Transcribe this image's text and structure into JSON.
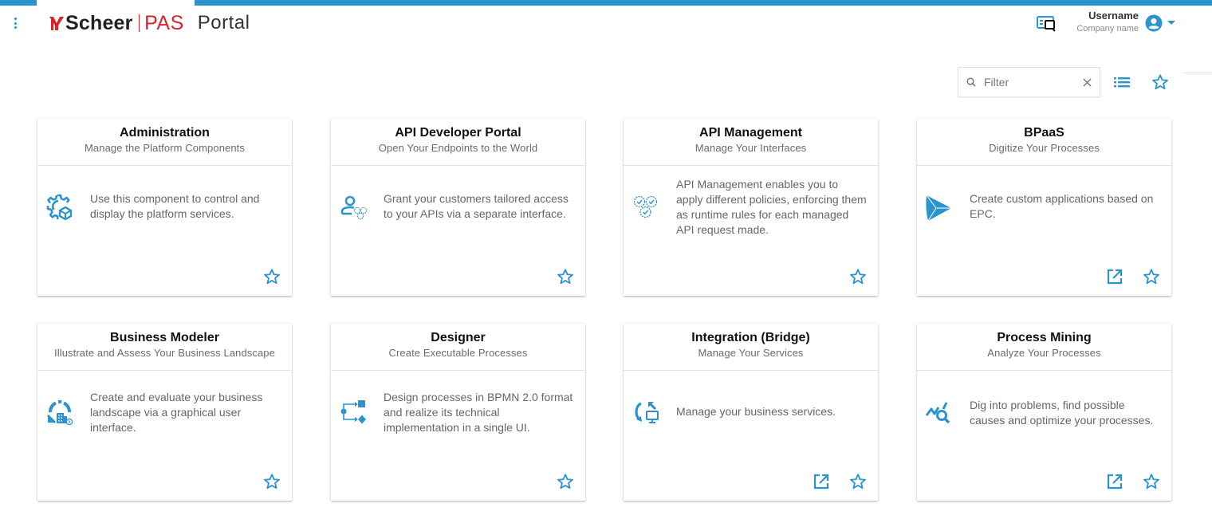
{
  "header": {
    "brand_name": "Scheer",
    "brand_product": "PAS",
    "app_title": "Portal",
    "user": {
      "name": "Username",
      "company": "Company name"
    },
    "icons": {
      "menu": "kebab-menu-icon",
      "inbox": "inbox-icon",
      "avatar": "account-circle-icon",
      "avatar_menu": "caret-down-icon"
    }
  },
  "toolbar": {
    "filter": {
      "placeholder": "Filter",
      "value": ""
    },
    "icons": {
      "search": "search-icon",
      "clear": "close-icon",
      "list_view": "list-view-icon",
      "favorites": "star-outline-icon"
    }
  },
  "colors": {
    "accent": "#2b93cd",
    "brand_red": "#d8232a"
  },
  "cards": [
    {
      "title": "Administration",
      "subtitle": "Manage the Platform Components",
      "description": "Use this component to control and display the platform services.",
      "icon": "gear-cube-icon",
      "has_open_link": false,
      "favorite": false
    },
    {
      "title": "API Developer Portal",
      "subtitle": "Open Your Endpoints to the World",
      "description": "Grant your customers tailored access to your APIs via a separate interface.",
      "icon": "user-gears-icon",
      "has_open_link": false,
      "favorite": false
    },
    {
      "title": "API Management",
      "subtitle": "Manage Your Interfaces",
      "description": "API Management enables you to apply different policies, enforcing them as runtime rules for each managed API request made.",
      "icon": "policy-gears-icon",
      "has_open_link": false,
      "favorite": false
    },
    {
      "title": "BPaaS",
      "subtitle": "Digitize Your Processes",
      "description": "Create custom applications based on EPC.",
      "icon": "bpaas-prism-icon",
      "has_open_link": true,
      "favorite": false
    },
    {
      "title": "Business Modeler",
      "subtitle": "Illustrate and Assess Your Business Landscape",
      "description": "Create and evaluate your business landscape via a graphical user interface.",
      "icon": "cycle-building-icon",
      "has_open_link": false,
      "favorite": false
    },
    {
      "title": "Designer",
      "subtitle": "Create Executable Processes",
      "description": "Design processes in BPMN 2.0 format and realize its technical implementation in a single UI.",
      "icon": "process-flow-icon",
      "has_open_link": false,
      "favorite": false
    },
    {
      "title": "Integration (Bridge)",
      "subtitle": "Manage Your Services",
      "description": "Manage your business services.",
      "icon": "sync-monitor-icon",
      "has_open_link": true,
      "favorite": false
    },
    {
      "title": "Process Mining",
      "subtitle": "Analyze Your Processes",
      "description": "Dig into problems, find possible causes and optimize your processes.",
      "icon": "chart-search-icon",
      "has_open_link": true,
      "favorite": false
    }
  ]
}
